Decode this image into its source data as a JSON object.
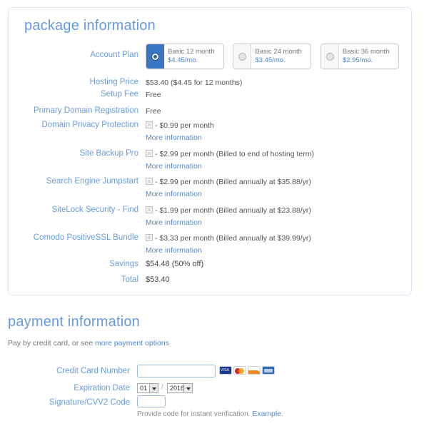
{
  "package": {
    "title": "package information",
    "account_plan_label": "Account Plan",
    "plans": [
      {
        "name": "Basic 12 month",
        "price": "$4.45/mo.",
        "selected": true
      },
      {
        "name": "Basic 24 month",
        "price": "$3.45/mo.",
        "selected": false
      },
      {
        "name": "Basic 36 month",
        "price": "$2.95/mo.",
        "selected": false
      }
    ],
    "rows": [
      {
        "label": "Hosting Price",
        "value": "$53.40  ($4.45 for 12 months)"
      },
      {
        "label": "Setup Fee",
        "value": "Free"
      },
      {
        "label": "Primary Domain Registration",
        "value": "Free"
      },
      {
        "label": "Domain Privacy Protection",
        "value": "- $0.99 per month",
        "more": "More information"
      },
      {
        "label": "Site Backup Pro",
        "value": "- $2.99 per month (Billed to end of hosting term)",
        "more": "More information"
      },
      {
        "label": "Search Engine Jumpstart",
        "value": "- $2.99 per month (Billed annually at $35.88/yr)",
        "more": "More information"
      },
      {
        "label": "SiteLock Security - Find",
        "value": "- $1.99 per month (Billed annually at $23.88/yr)",
        "more": "More information"
      },
      {
        "label": "Comodo PositiveSSL Bundle",
        "value": "- $3.33 per month (Billed annually at $39.99/yr)",
        "more": "More information"
      }
    ],
    "savings_label": "Savings",
    "savings_value": "$54.48 (50% off)",
    "total_label": "Total",
    "total_value": "$53.40"
  },
  "payment": {
    "title": "payment information",
    "subtitle_text": "Pay by credit card, or see ",
    "subtitle_link": "more payment options",
    "card_number_label": "Credit Card Number",
    "card_number_value": "",
    "expiration_label": "Expiration Date",
    "expiration_month": "01",
    "expiration_separator": "/",
    "expiration_year": "2016",
    "cvv_label": "Signature/CVV2 Code",
    "cvv_value": "",
    "hint_text": "Provide code for instant verification. ",
    "hint_link": "Example.",
    "accepted_cards": [
      "visa-card-icon",
      "mastercard-card-icon",
      "discover-card-icon",
      "amex-card-icon"
    ]
  },
  "colors": {
    "label_blue": "#6b9bd8",
    "heading_blue": "#6699dd",
    "link_blue": "#5588cc",
    "selected_plan_blue": "#3a76c4",
    "card_border": "#d9e6f5"
  }
}
